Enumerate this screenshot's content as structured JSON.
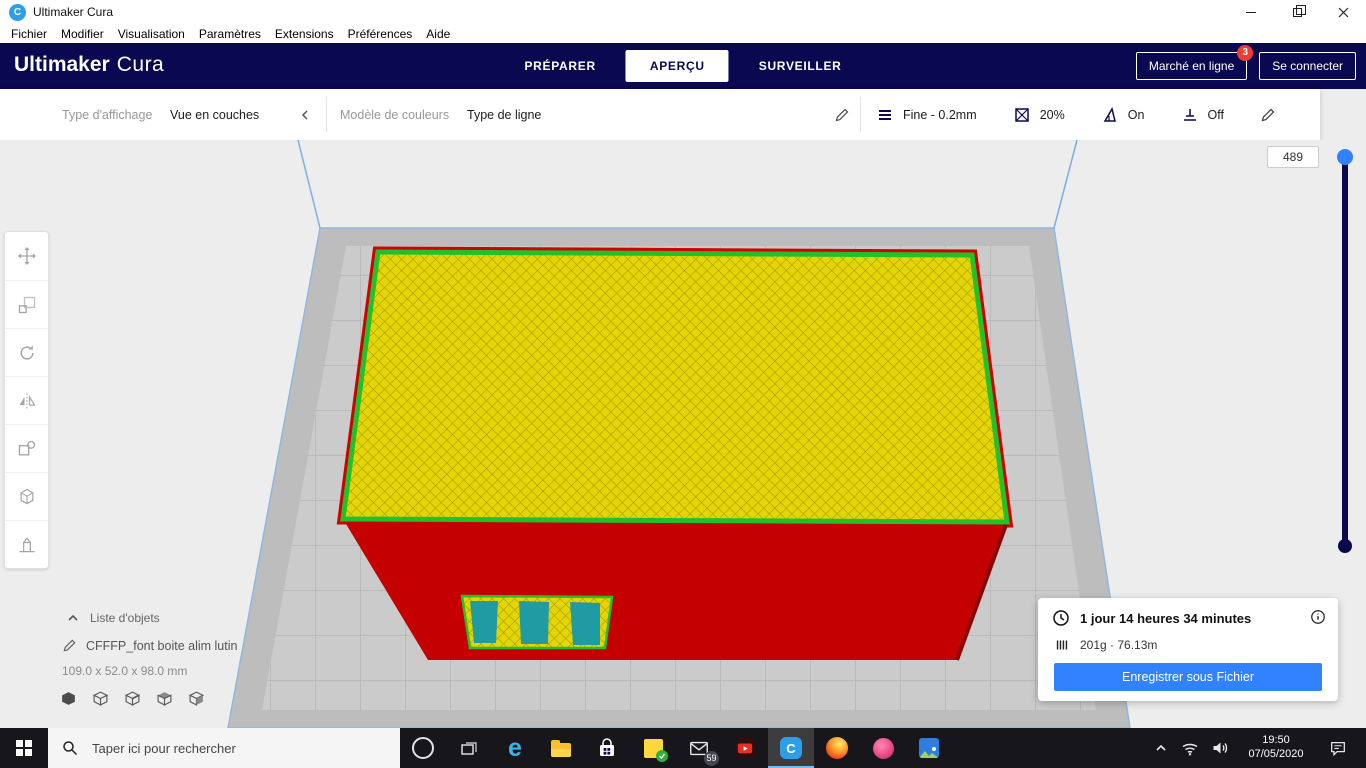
{
  "window": {
    "title": "Ultimaker Cura"
  },
  "menu_bar": {
    "items": [
      "Fichier",
      "Modifier",
      "Visualisation",
      "Paramètres",
      "Extensions",
      "Préférences",
      "Aide"
    ]
  },
  "header": {
    "logo_primary": "Ultimaker",
    "logo_secondary": "Cura",
    "tabs": [
      {
        "label": "PRÉPARER"
      },
      {
        "label": "APERÇU"
      },
      {
        "label": "SURVEILLER"
      }
    ],
    "active_tab": "APERÇU",
    "marketplace_button": "Marché en ligne",
    "marketplace_badge": "3",
    "sign_in_button": "Se connecter"
  },
  "view_options": {
    "display_type_label": "Type d'affichage",
    "display_type_value": "Vue en couches",
    "color_scheme_label": "Modèle de couleurs",
    "color_scheme_value": "Type de ligne"
  },
  "print_setup": {
    "profile": "Fine - 0.2mm",
    "infill_percent": "20%",
    "support": "On",
    "adhesion": "Off"
  },
  "layer_slider": {
    "current_layer": "489"
  },
  "scene": {
    "object_list_label": "Liste d'objets",
    "job_name": "CFFFP_font boite alim lutin",
    "model_dimensions": "109.0 x 52.0 x 98.0 mm"
  },
  "output": {
    "print_time": "1 jour 14 heures 34 minutes",
    "material_usage": "201g · 76.13m",
    "save_button": "Enregistrer sous Fichier"
  },
  "taskbar": {
    "search_placeholder": "Taper ici pour rechercher",
    "mail_badge": "59",
    "clock_time": "19:50",
    "clock_date": "07/05/2020"
  },
  "icons": {
    "cura": "C",
    "edge": "e"
  },
  "colors": {
    "accent": "#3282ff",
    "header_bg": "#0a0850",
    "badge_red": "#f23b37",
    "model_red": "#c40000",
    "model_yellow": "#e4d504",
    "model_green": "#22c12c",
    "model_teal": "#1f9ba3"
  }
}
